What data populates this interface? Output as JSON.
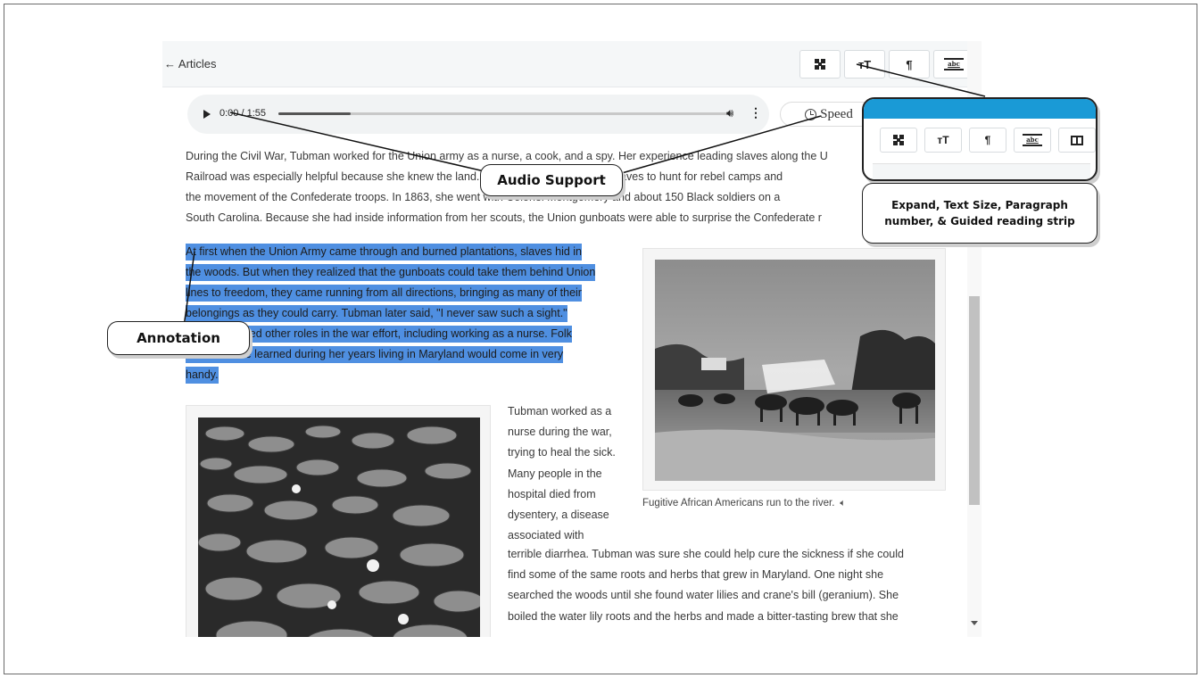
{
  "toolbar": {
    "back_label": "← Articles",
    "expand_icon": "expand-icon",
    "text_size_label": "тT",
    "paragraph_label": "¶",
    "guided_strip_label": "abc"
  },
  "audio": {
    "time": "0:00 / 1:55",
    "progress": 0.16,
    "speed_label": "Speed"
  },
  "article": {
    "paragraph1_lines": [
      "During the Civil War, Tubman worked for the Union army as a nurse, a cook, and a spy. Her experience leading slaves along the U",
      "Railroad was especially helpful because she knew the land. She led a group of former slaves to hunt for rebel camps and",
      "the movement of the Confederate troops. In 1863, she went with Colonel Montgomery and about 150 Black soldiers on a",
      "South Carolina. Because she had inside information from her scouts, the Union gunboats were able to surprise the Confederate r"
    ],
    "highlighted_lines": [
      "At first when the Union Army came through and burned plantations, slaves hid in",
      "the woods. But when they realized that the gunboats could take them behind Union",
      "lines to freedom, they came running from all directions, bringing as many of their",
      "belongings as they could carry. Tubman later said, \"I never saw such a sight.\"",
      "Tubman played other roles in the war effort, including working as a nurse. Folk",
      "medicine she learned during her years living in Maryland would come in very",
      "handy."
    ],
    "side_text_lines": [
      "Tubman worked as a",
      "nurse during the war,",
      "trying to heal the sick.",
      "Many people in the",
      "hospital died from",
      "dysentery, a disease",
      "associated with"
    ],
    "bottom_lines": [
      "terrible diarrhea. Tubman was sure she could help cure the sickness if she could",
      "find some of the same roots and herbs that grew in Maryland. One night she",
      "searched the woods until she found water lilies and crane's bill (geranium). She",
      "boiled the water lily roots and the herbs and made a bitter-tasting brew that she"
    ],
    "photo_caption": "Fugitive African Americans run to the river."
  },
  "callouts": {
    "audio": "Audio Support",
    "annotation": "Annotation",
    "tools": "Expand, Text Size, Paragraph number, & Guided reading strip"
  },
  "colors": {
    "highlight": "#4f8fe1",
    "panel_header": "#1a9ad6"
  }
}
